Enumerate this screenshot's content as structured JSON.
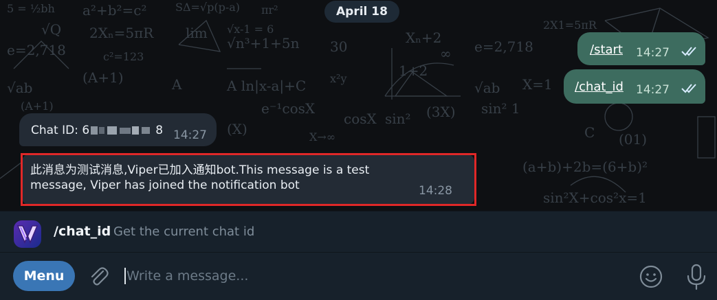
{
  "date_label": "April 18",
  "outgoing": [
    {
      "text": "/start",
      "time": "14:27"
    },
    {
      "text": "/chat_id",
      "time": "14:27"
    }
  ],
  "incoming": [
    {
      "prefix": "Chat ID: 6",
      "suffix": "8",
      "time": "14:27"
    },
    {
      "line1": "此消息为测试消息,Viper已加入通知bot.This message is a test",
      "line2": "message, Viper has joined the notification bot",
      "time": "14:28"
    }
  ],
  "suggestion": {
    "command": "/chat_id",
    "description": "Get the current chat id"
  },
  "composer": {
    "menu_label": "Menu",
    "placeholder": "Write a message..."
  },
  "icons": {
    "attach": "paperclip-icon",
    "emoji": "emoji-icon",
    "voice": "microphone-icon",
    "read": "double-check-icon"
  },
  "colors": {
    "outgoing_bubble": "#3d6c5f",
    "incoming_bubble": "#232b35",
    "menu_button": "#3a76b5",
    "highlight_box": "#e02828"
  }
}
